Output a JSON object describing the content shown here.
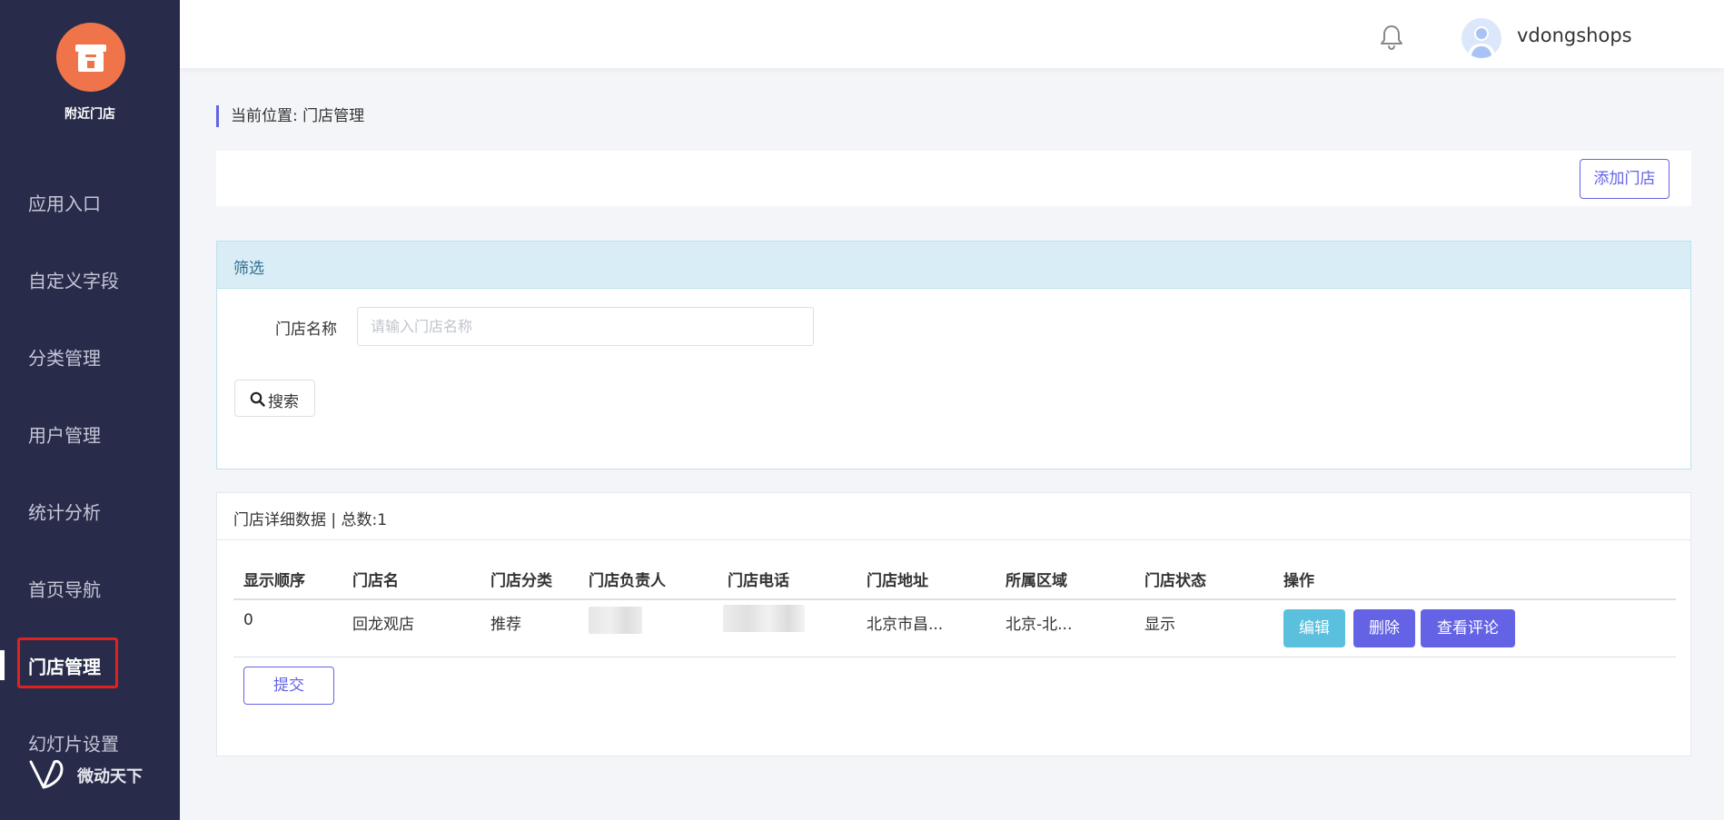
{
  "sidebar": {
    "app_name": "附近门店",
    "items": [
      {
        "label": "应用入口"
      },
      {
        "label": "自定义字段"
      },
      {
        "label": "分类管理"
      },
      {
        "label": "用户管理"
      },
      {
        "label": "统计分析"
      },
      {
        "label": "首页导航"
      },
      {
        "label": "门店管理",
        "active": true
      },
      {
        "label": "幻灯片设置"
      }
    ],
    "brand": "微动天下",
    "logo_icon": "store-icon",
    "brand_icon": "vdong-logo-icon"
  },
  "header": {
    "username": "vdongshops",
    "bell_icon": "bell-icon",
    "avatar_icon": "user-avatar-icon"
  },
  "breadcrumb": {
    "text": "当前位置:  门店管理"
  },
  "actions": {
    "add_store": "添加门店"
  },
  "filter": {
    "title": "筛选",
    "name_label": "门店名称",
    "name_placeholder": "请输入门店名称",
    "name_value": "",
    "search_label": "搜索"
  },
  "table": {
    "title": "门店详细数据 | 总数:1",
    "columns": [
      "显示顺序",
      "门店名",
      "门店分类",
      "门店负责人",
      "门店电话",
      "门店地址",
      "所属区域",
      "门店状态",
      "操作"
    ],
    "rows": [
      {
        "order": "0",
        "name": "回龙观店",
        "category": "推荐",
        "manager": "",
        "phone": "",
        "address": "北京市昌...",
        "region": "北京-北...",
        "status": "显示",
        "edit": "编辑",
        "delete": "删除",
        "review": "查看评论"
      }
    ],
    "submit": "提交"
  },
  "colors": {
    "sidebar_bg": "#282c4a",
    "accent": "#6463e6",
    "info": "#5bc0de",
    "logo": "#f0744a",
    "highlight": "#e0221e"
  }
}
